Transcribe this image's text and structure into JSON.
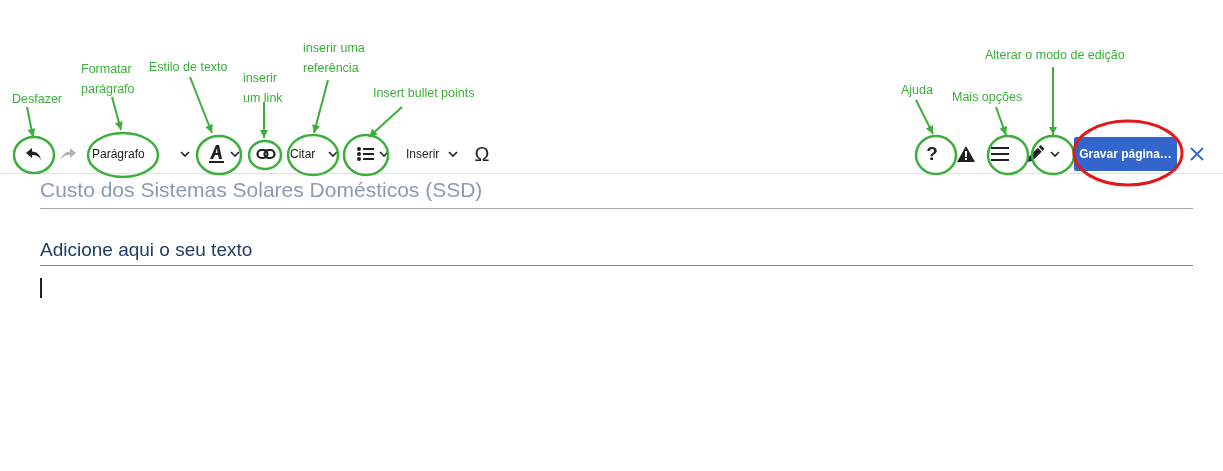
{
  "toolbar": [
    {
      "kind": "undo",
      "disabled": false
    },
    {
      "kind": "redo",
      "disabled": true
    },
    {
      "kind": "dropdown",
      "label": "Parágrafo"
    },
    {
      "kind": "text-style"
    },
    {
      "kind": "link"
    },
    {
      "kind": "dropdown",
      "label": "Citar"
    },
    {
      "kind": "list"
    },
    {
      "kind": "dropdown",
      "label": "Inserir"
    },
    {
      "kind": "char",
      "label": "Ω"
    }
  ],
  "toolbar_right": [
    {
      "kind": "char",
      "label": "?"
    },
    {
      "kind": "warning"
    },
    {
      "kind": "menu"
    },
    {
      "kind": "edit-mode"
    },
    {
      "kind": "primary",
      "label": "Gravar página…"
    },
    {
      "kind": "close"
    }
  ],
  "document": {
    "title": "Custo dos Sistemas Solares Domésticos (SSD)",
    "heading": "Adicione aqui o seu texto"
  },
  "annotations": [
    {
      "label": "Desfazer",
      "color": "#3cae3a"
    },
    {
      "label": "Formatar parágrafo",
      "color": "#3cae3a"
    },
    {
      "label": "Estilo de texto",
      "color": "#3cae3a"
    },
    {
      "label": "inserir um link",
      "color": "#3cae3a"
    },
    {
      "label": "inserir uma referência",
      "color": "#3cae3a"
    },
    {
      "label": "Insert bullet points",
      "color": "#3cae3a"
    },
    {
      "label": "Ajuda",
      "color": "#3cae3a"
    },
    {
      "label": "Mais opções",
      "color": "#3cae3a"
    },
    {
      "label": "Alterar o modo de edição",
      "color": "#3cae3a"
    },
    {
      "color": "#e0191b"
    }
  ]
}
